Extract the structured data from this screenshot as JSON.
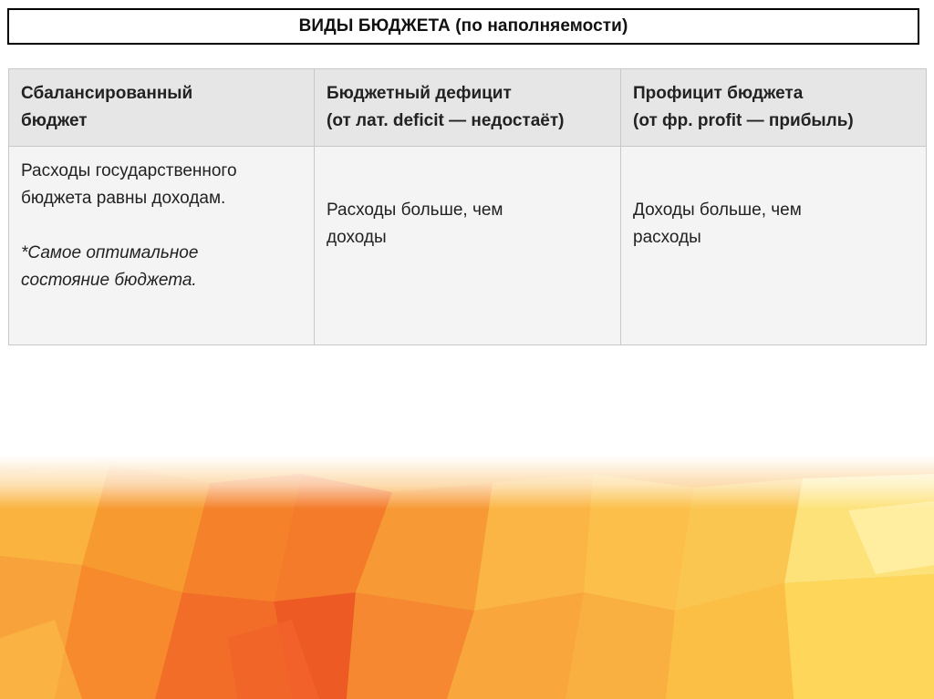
{
  "title": "ВИДЫ БЮДЖЕТА (по наполняемости)",
  "table": {
    "headers": [
      {
        "line1": "Сбалансированный",
        "line2": "бюджет"
      },
      {
        "line1": "Бюджетный дефицит",
        "line2": "(от лат. deficit — недостаёт)"
      },
      {
        "line1": "Профицит бюджета",
        "line2": "(от фр. profit — прибыль)"
      }
    ],
    "row": {
      "balanced": {
        "line1": "Расходы государственного",
        "line2": "бюджета равны доходам.",
        "note_line1": "*Самое оптимальное",
        "note_line2": "состояние бюджета."
      },
      "deficit": {
        "line1": "Расходы больше, чем",
        "line2": "доходы"
      },
      "surplus": {
        "line1": "Доходы больше, чем",
        "line2": "расходы"
      }
    }
  },
  "colors": {
    "accent_orange": "#f39a2a",
    "accent_yellow": "#fbd34a",
    "accent_red": "#ee5a24"
  }
}
